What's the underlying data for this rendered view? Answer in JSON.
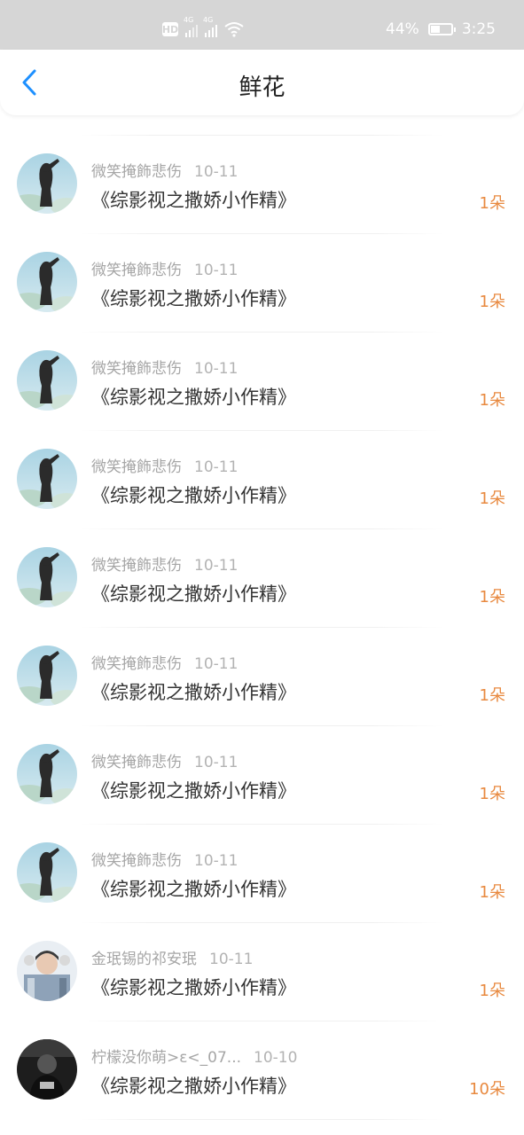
{
  "status_bar": {
    "hd": "HD",
    "network_1": "4G",
    "network_2": "4G",
    "battery": "44%",
    "time": "3:25"
  },
  "header": {
    "title": "鲜花"
  },
  "items": [
    {
      "user": "微笑掩飾悲伤",
      "date": "10-11",
      "book": "《综影视之撒娇小作精》",
      "count": "1朵",
      "avatar": "woman-photo"
    },
    {
      "user": "微笑掩飾悲伤",
      "date": "10-11",
      "book": "《综影视之撒娇小作精》",
      "count": "1朵",
      "avatar": "woman-photo"
    },
    {
      "user": "微笑掩飾悲伤",
      "date": "10-11",
      "book": "《综影视之撒娇小作精》",
      "count": "1朵",
      "avatar": "woman-photo"
    },
    {
      "user": "微笑掩飾悲伤",
      "date": "10-11",
      "book": "《综影视之撒娇小作精》",
      "count": "1朵",
      "avatar": "woman-photo"
    },
    {
      "user": "微笑掩飾悲伤",
      "date": "10-11",
      "book": "《综影视之撒娇小作精》",
      "count": "1朵",
      "avatar": "woman-photo"
    },
    {
      "user": "微笑掩飾悲伤",
      "date": "10-11",
      "book": "《综影视之撒娇小作精》",
      "count": "1朵",
      "avatar": "woman-photo"
    },
    {
      "user": "微笑掩飾悲伤",
      "date": "10-11",
      "book": "《综影视之撒娇小作精》",
      "count": "1朵",
      "avatar": "woman-photo"
    },
    {
      "user": "微笑掩飾悲伤",
      "date": "10-11",
      "book": "《综影视之撒娇小作精》",
      "count": "1朵",
      "avatar": "woman-photo"
    },
    {
      "user": "金珉锡的祁安珉",
      "date": "10-11",
      "book": "《综影视之撒娇小作精》",
      "count": "1朵",
      "avatar": "man-photo"
    },
    {
      "user": "柠檬没你萌>ε<_07...",
      "date": "10-10",
      "book": "《综影视之撒娇小作精》",
      "count": "10朵",
      "avatar": "bw-photo"
    }
  ],
  "colors": {
    "accent": "#1e90ff",
    "flower_count": "#e8893f",
    "status_bar_bg": "#d6d6d6"
  }
}
